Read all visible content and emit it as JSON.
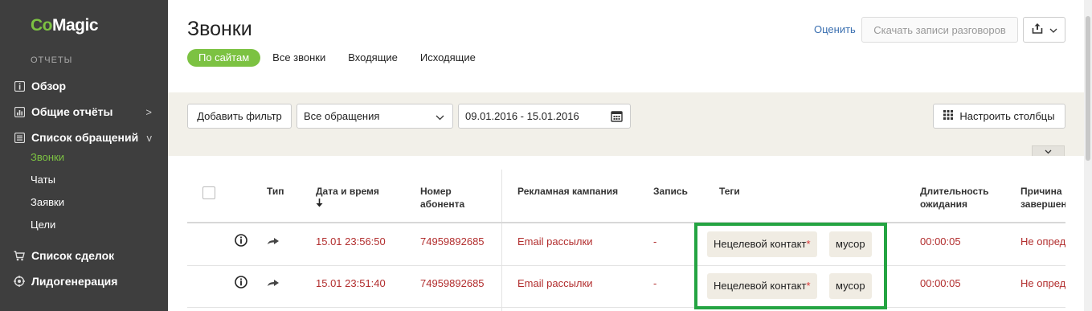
{
  "sidebar": {
    "logo_co": "Co",
    "logo_magic": "Magic",
    "section_label": "ОТЧЕТЫ",
    "items": [
      {
        "label": "Обзор",
        "icon": "info-icon"
      },
      {
        "label": "Общие отчёты",
        "icon": "chart-icon",
        "arrow": ">"
      },
      {
        "label": "Список обращений",
        "icon": "list-icon",
        "arrow": "v"
      },
      {
        "label": "Список сделок",
        "icon": "cart-icon"
      },
      {
        "label": "Лидогенерация",
        "icon": "target-icon"
      }
    ],
    "sub_items": [
      "Звонки",
      "Чаты",
      "Заявки",
      "Цели"
    ]
  },
  "header": {
    "title": "Звонки",
    "tabs": [
      "По сайтам",
      "Все звонки",
      "Входящие",
      "Исходящие"
    ],
    "rate_link": "Оценить",
    "download_label": "Скачать записи разговоров"
  },
  "filters": {
    "add_filter": "Добавить фильтр",
    "select_value": "Все обращения",
    "date_range": "09.01.2016 - 15.01.2016",
    "columns_button": "Настроить столбцы"
  },
  "table": {
    "columns": {
      "type": "Тип",
      "datetime": "Дата и время",
      "number_l1": "Номер",
      "number_l2": "абонента",
      "campaign": "Рекламная кампания",
      "record": "Запись",
      "tags": "Теги",
      "wait_l1": "Длительность",
      "wait_l2": "ожидания",
      "reason_l1": "Причина",
      "reason_l2": "завершен"
    },
    "rows": [
      {
        "datetime": "15.01 23:56:50",
        "number": "74959892685",
        "campaign": "Email рассылки",
        "record": "-",
        "tag1": "Нецелевой контакт",
        "tag1_mark": "*",
        "tag2": "мусор",
        "wait": "00:00:05",
        "reason": "Не опред"
      },
      {
        "datetime": "15.01 23:51:40",
        "number": "74959892685",
        "campaign": "Email рассылки",
        "record": "-",
        "tag1": "Нецелевой контакт",
        "tag1_mark": "*",
        "tag2": "мусор",
        "wait": "00:00:05",
        "reason": "Не опред"
      }
    ]
  },
  "colors": {
    "accent": "#7cc242",
    "sidebar_bg": "#3e3e3e",
    "link": "#3a6fb0",
    "row_text": "#b22e2e",
    "highlight": "#24a442"
  }
}
